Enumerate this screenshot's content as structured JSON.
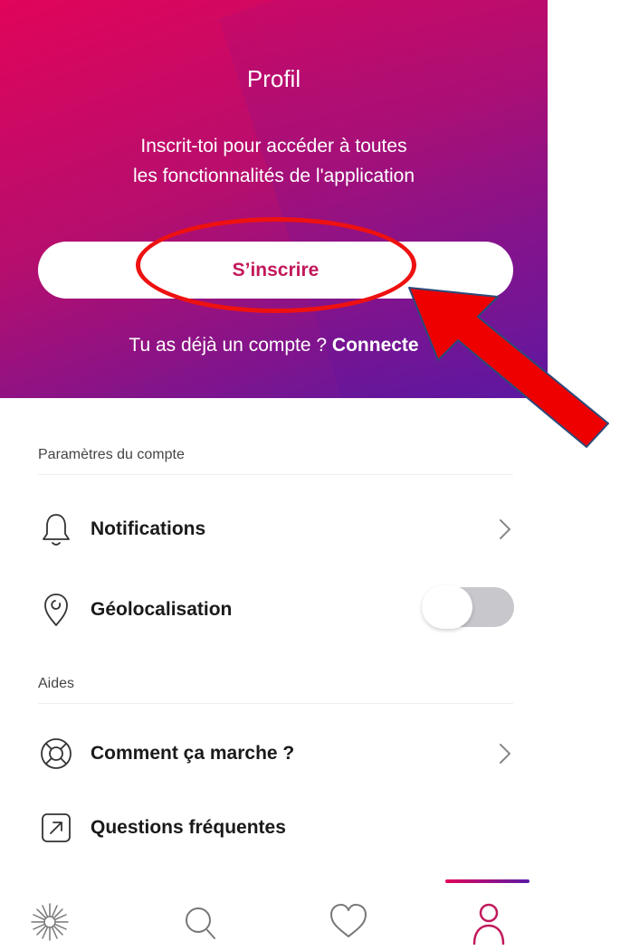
{
  "header": {
    "title": "Profil",
    "subtitle_line1": "Inscrit-toi pour accéder à toutes",
    "subtitle_line2": "les fonctionnalités de l'application",
    "signup_label": "S’inscrire",
    "login_prompt": "Tu as déjà un compte ? ",
    "login_link": "Connecte"
  },
  "account_settings": {
    "section_label": "Paramètres du compte",
    "items": [
      {
        "label": "Notifications",
        "icon": "bell-icon",
        "control": "chevron"
      },
      {
        "label": "Géolocalisation",
        "icon": "location-pin-icon",
        "control": "toggle",
        "enabled": false
      }
    ]
  },
  "help": {
    "section_label": "Aides",
    "items": [
      {
        "label": "Comment ça marche ?",
        "icon": "lifebuoy-icon",
        "control": "chevron"
      },
      {
        "label": "Questions fréquentes",
        "icon": "external-arrow-icon",
        "control": "none"
      }
    ]
  },
  "tab_bar": {
    "tabs": [
      {
        "icon": "sparkle-icon",
        "active": false
      },
      {
        "icon": "search-icon",
        "active": false
      },
      {
        "icon": "heart-icon",
        "active": false
      },
      {
        "icon": "profile-icon",
        "active": true
      }
    ]
  },
  "colors": {
    "brand_pink": "#e1045a",
    "brand_purple": "#5a1aa6",
    "signup_text": "#c2185b",
    "annotation_red": "#ee1111"
  }
}
